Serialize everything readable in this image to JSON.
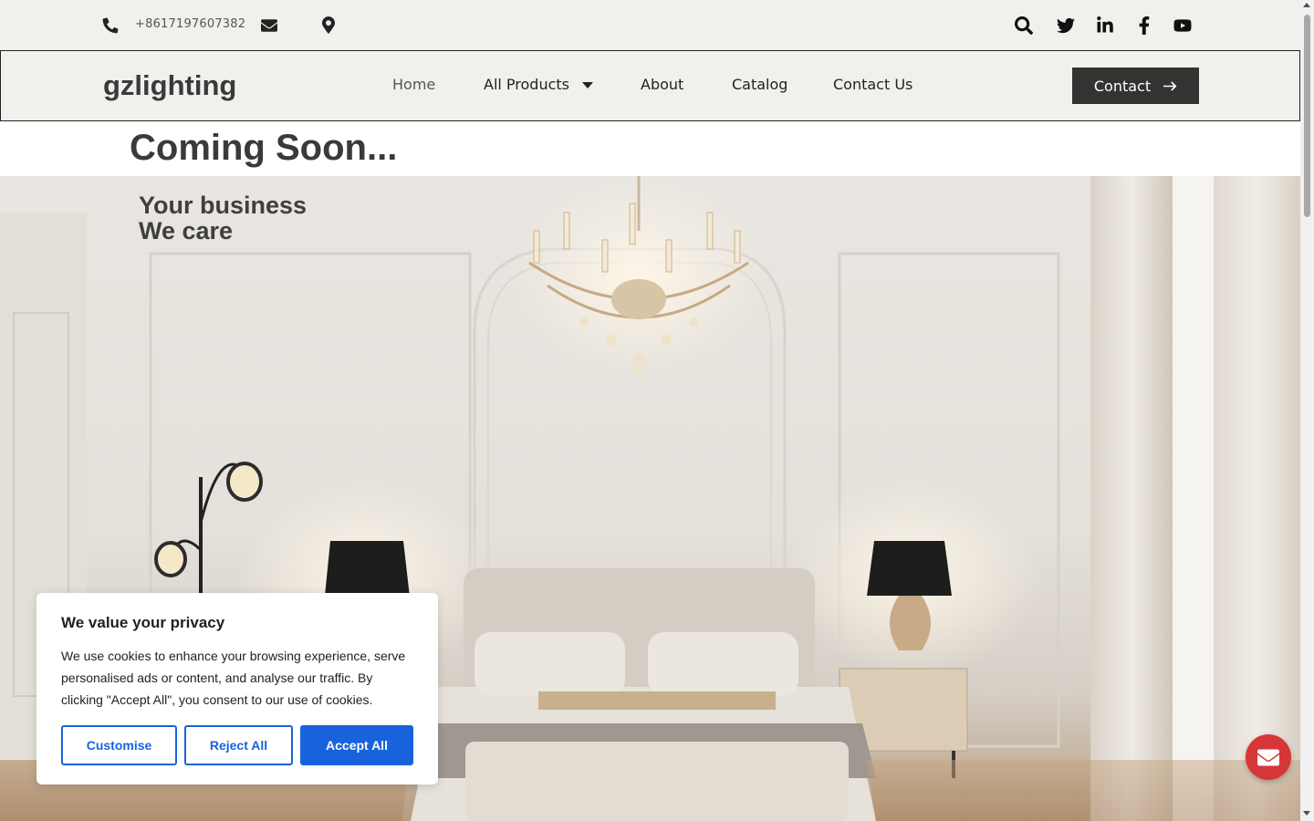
{
  "topbar": {
    "phone": "+8617197607382",
    "icons": [
      "phone-icon",
      "envelope-icon",
      "map-pin-icon"
    ],
    "social_icons": [
      "search-icon",
      "twitter-icon",
      "linkedin-icon",
      "facebook-icon",
      "youtube-icon"
    ]
  },
  "header": {
    "logo": "gzlighting",
    "nav": [
      {
        "label": "Home",
        "active": true
      },
      {
        "label": "All Products",
        "has_dropdown": true
      },
      {
        "label": "About"
      },
      {
        "label": "Catalog"
      },
      {
        "label": "Contact Us"
      }
    ],
    "cta": {
      "label": "Contact",
      "icon": "arrow-right-icon"
    }
  },
  "main": {
    "heading": "Coming Soon...",
    "tagline_line1": "Your business",
    "tagline_line2": "We care"
  },
  "cookie": {
    "title": "We value your privacy",
    "text": "We use cookies to enhance your browsing experience, serve personalised ads or content, and analyse our traffic. By clicking \"Accept All\", you consent to our use of cookies.",
    "customise": "Customise",
    "reject": "Reject All",
    "accept": "Accept All"
  },
  "floating": {
    "icon": "envelope-icon"
  },
  "colors": {
    "topbar_bg": "#f1f0ed",
    "cta_bg": "#333331",
    "cookie_accent": "#1863dc",
    "float_button": "#d63638"
  }
}
